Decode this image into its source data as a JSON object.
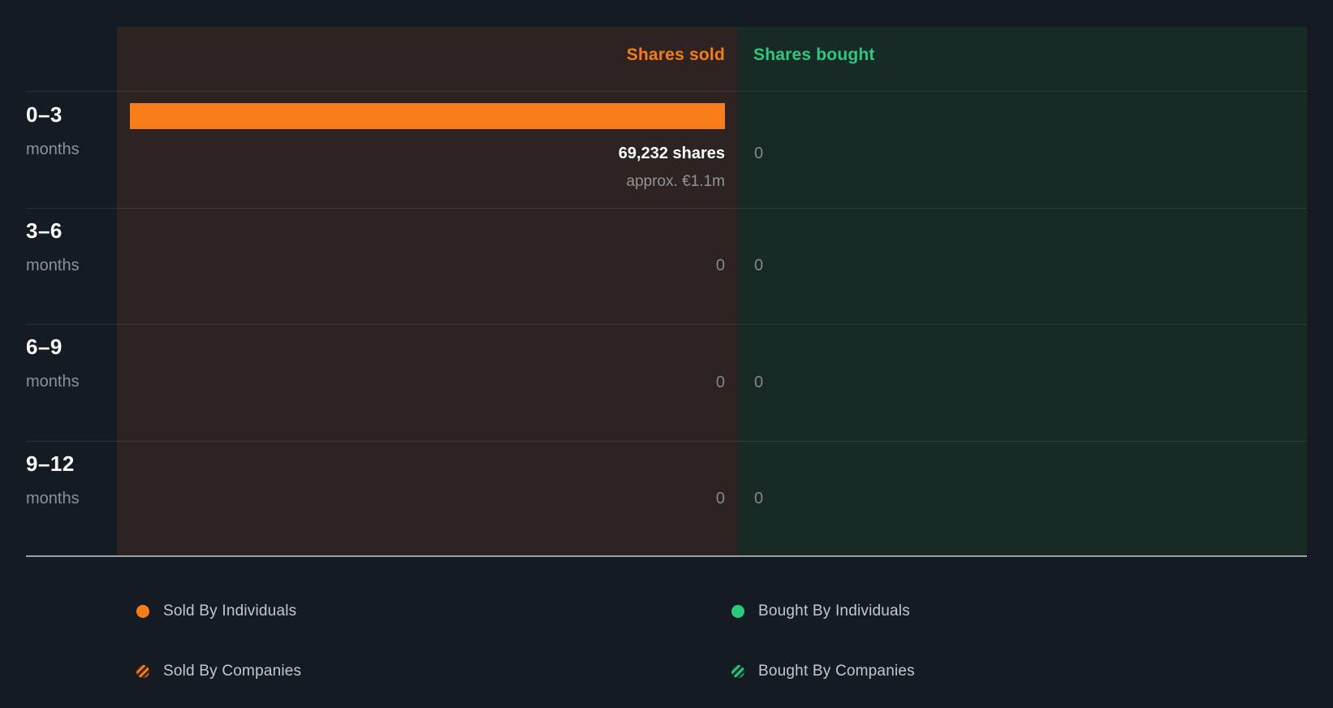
{
  "header": {
    "sold": "Shares sold",
    "bought": "Shares bought"
  },
  "rows": [
    {
      "period": "0–3",
      "unit": "months",
      "sold_shares": "69,232 shares",
      "sold_approx": "approx. €1.1m",
      "bought": "0"
    },
    {
      "period": "3–6",
      "unit": "months",
      "sold": "0",
      "bought": "0"
    },
    {
      "period": "6–9",
      "unit": "months",
      "sold": "0",
      "bought": "0"
    },
    {
      "period": "9–12",
      "unit": "months",
      "sold": "0",
      "bought": "0"
    }
  ],
  "legend": {
    "items": [
      {
        "id": "sold-individuals",
        "label": "Sold By Individuals",
        "swatch": "solid-orange"
      },
      {
        "id": "sold-companies",
        "label": "Sold By Companies",
        "swatch": "striped-orange"
      },
      {
        "id": "bought-individuals",
        "label": "Bought By Individuals",
        "swatch": "solid-green"
      },
      {
        "id": "bought-companies",
        "label": "Bought By Companies",
        "swatch": "striped-green"
      }
    ]
  },
  "colors": {
    "background": "#151b23",
    "sold_panel": "#2d2421",
    "bought_panel": "#172a25",
    "sold_accent": "#f87c17",
    "bought_accent": "#2bc97f"
  },
  "chart_data": {
    "type": "bar",
    "orientation": "horizontal",
    "title": "",
    "categories": [
      "0–3 months",
      "3–6 months",
      "6–9 months",
      "9–12 months"
    ],
    "series": [
      {
        "name": "Shares sold",
        "values": [
          69232,
          0,
          0,
          0
        ],
        "approx_labels": [
          "approx. €1.1m",
          "",
          "",
          ""
        ],
        "color": "#f87c17"
      },
      {
        "name": "Shares bought",
        "values": [
          0,
          0,
          0,
          0
        ],
        "color": "#2bc97f"
      }
    ],
    "xlim": [
      0,
      69232
    ],
    "grid": "horizontal-row-separators",
    "legend_position": "bottom"
  }
}
